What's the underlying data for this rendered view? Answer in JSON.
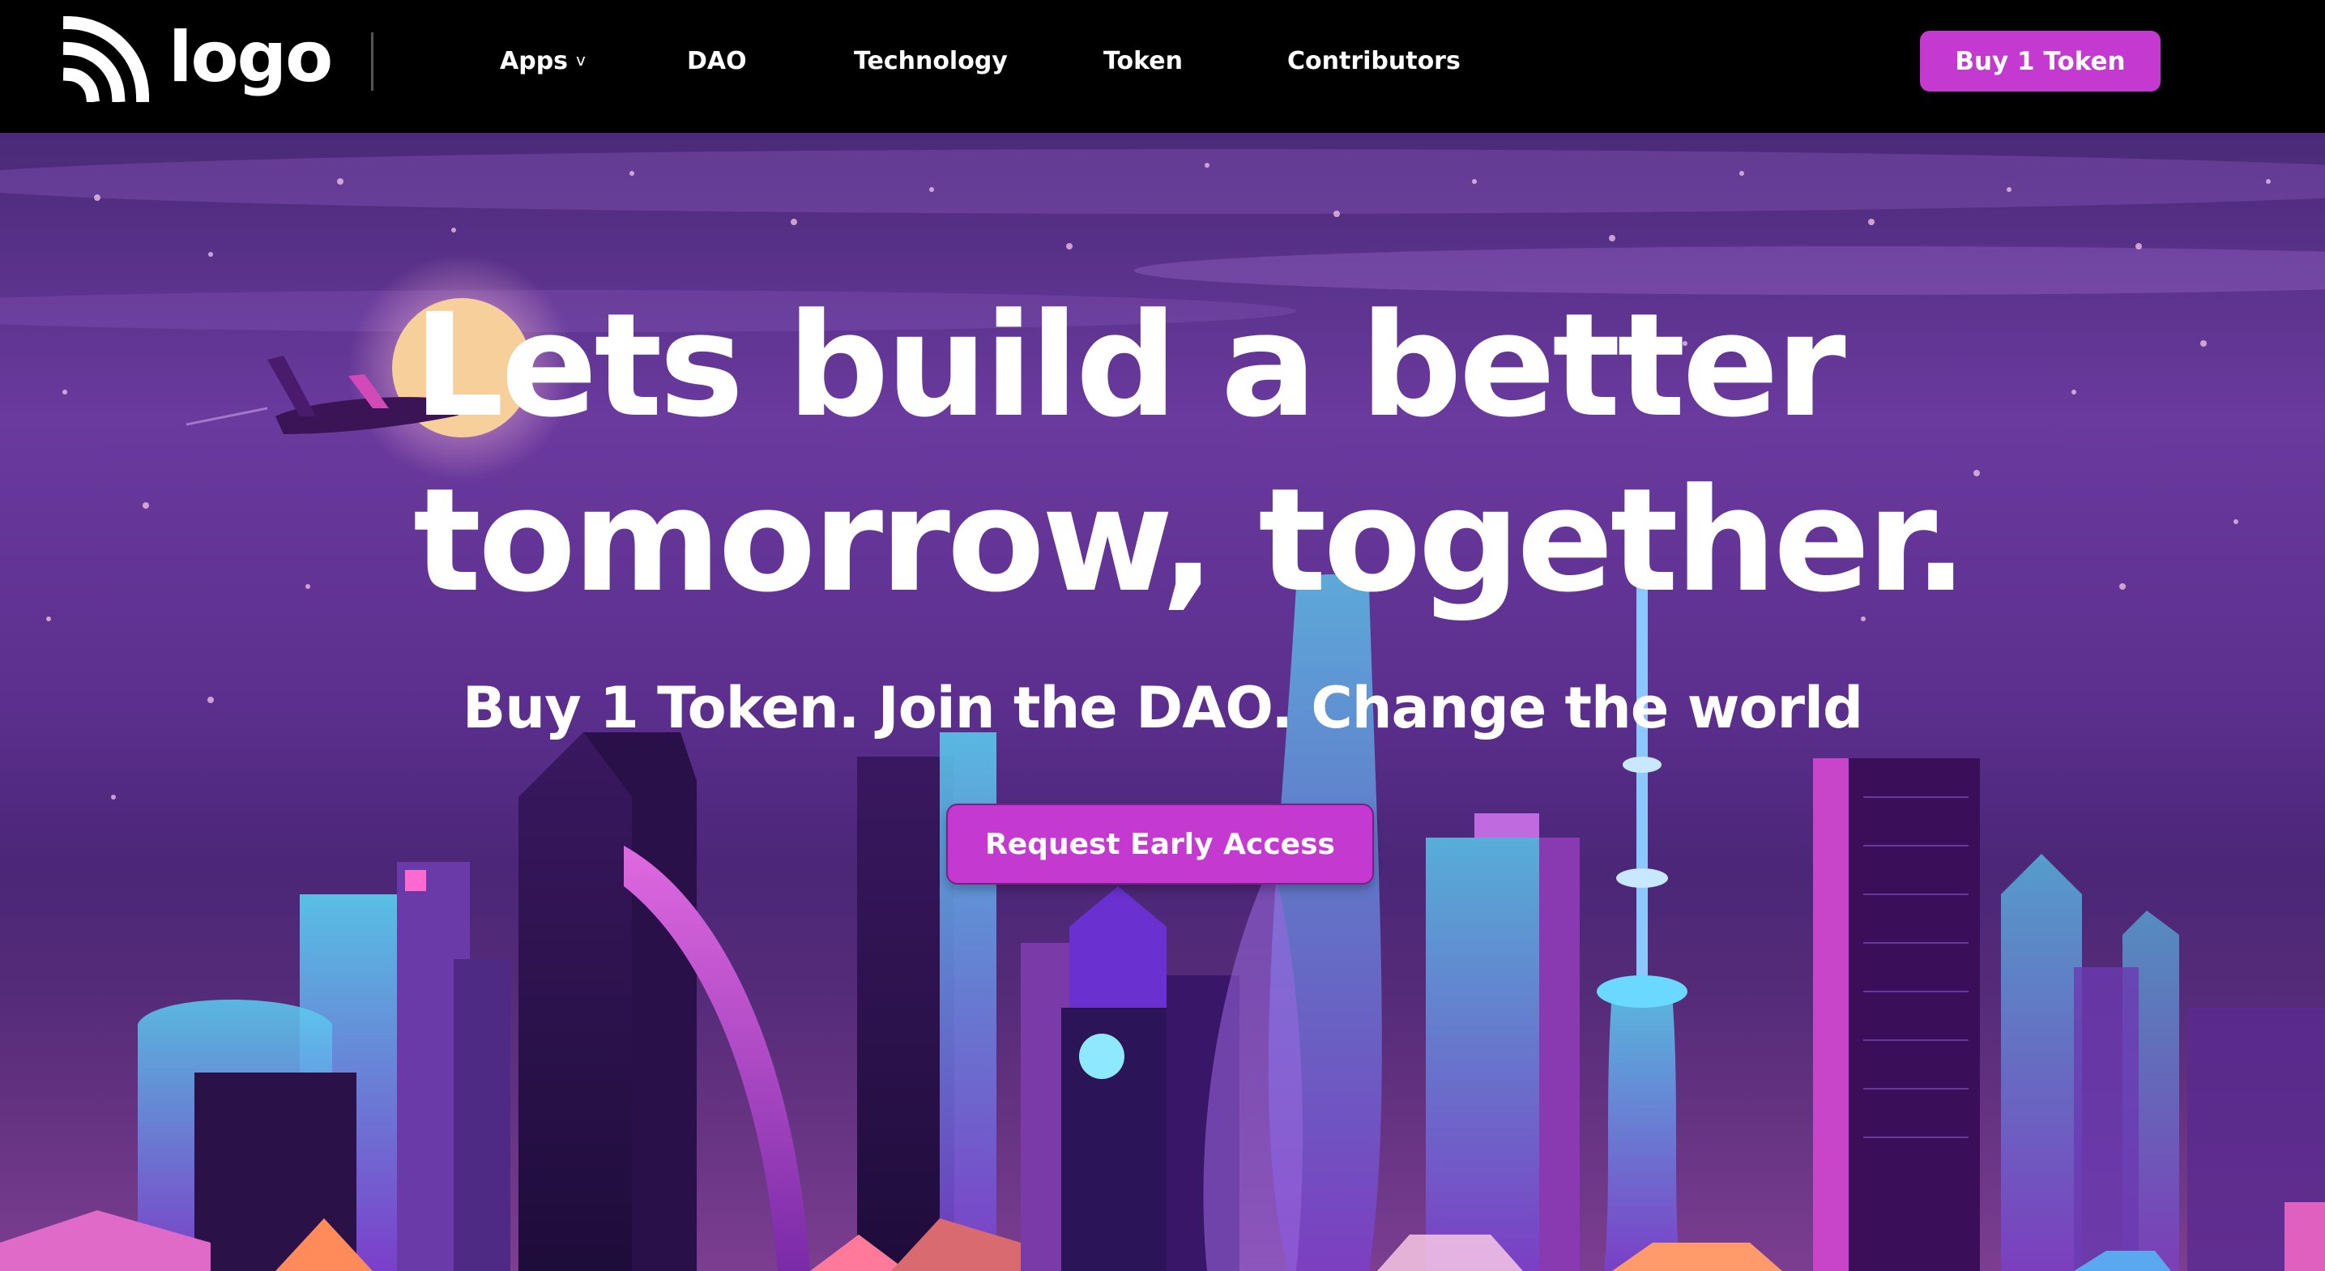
{
  "nav": {
    "logo_text": "logo",
    "items": [
      {
        "label": "Apps",
        "chevron": "v"
      },
      {
        "label": "DAO"
      },
      {
        "label": "Technology"
      },
      {
        "label": "Token"
      },
      {
        "label": "Contributors"
      }
    ],
    "buy_label": "Buy 1 Token"
  },
  "hero": {
    "headline_line1": "Lets build a better",
    "headline_line2": "tomorrow, together.",
    "subheadline": "Buy 1 Token. Join the DAO. Change the world",
    "cta_label": "Request Early Access"
  },
  "colors": {
    "nav_bg": "#000000",
    "accent": "#c43ad0",
    "hero_bg": "#5c2f8e",
    "text": "#ffffff"
  },
  "icons": {
    "logo": "signal-arcs-icon",
    "apps_dropdown": "chevron-down-icon"
  }
}
